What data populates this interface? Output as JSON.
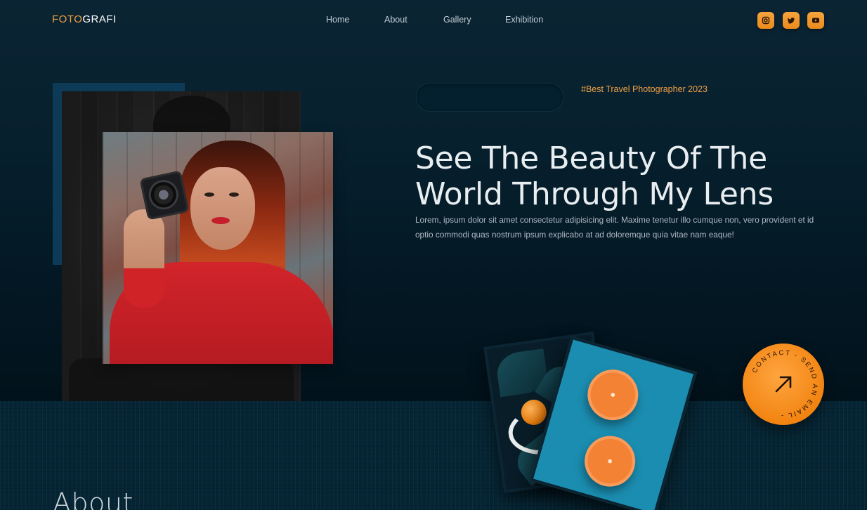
{
  "brand": {
    "logo_part1": "FOTO",
    "logo_part2": "GRAFI",
    "accent": "#f0a143"
  },
  "nav": {
    "items": [
      "Home",
      "About",
      "Gallery",
      "Exhibition"
    ]
  },
  "social": [
    "instagram-icon",
    "twitter-icon",
    "youtube-icon"
  ],
  "hero": {
    "tag": "#Best Travel Photographer 2023",
    "headline_line1": "See The Beauty Of The",
    "headline_line2": "World Through My Lens",
    "description": "Lorem, ipsum dolor sit amet consectetur adipisicing elit. Maxime tenetur illo cumque non, vero provident et id optio commodi quas nostrum ipsum explicabo at ad doloremque quia vitae nam eaque!"
  },
  "contact_badge": {
    "ring_text": "CONTACT - SEND AN EMAIL -",
    "icon": "arrow-up-right-icon"
  },
  "about": {
    "title": "About"
  }
}
